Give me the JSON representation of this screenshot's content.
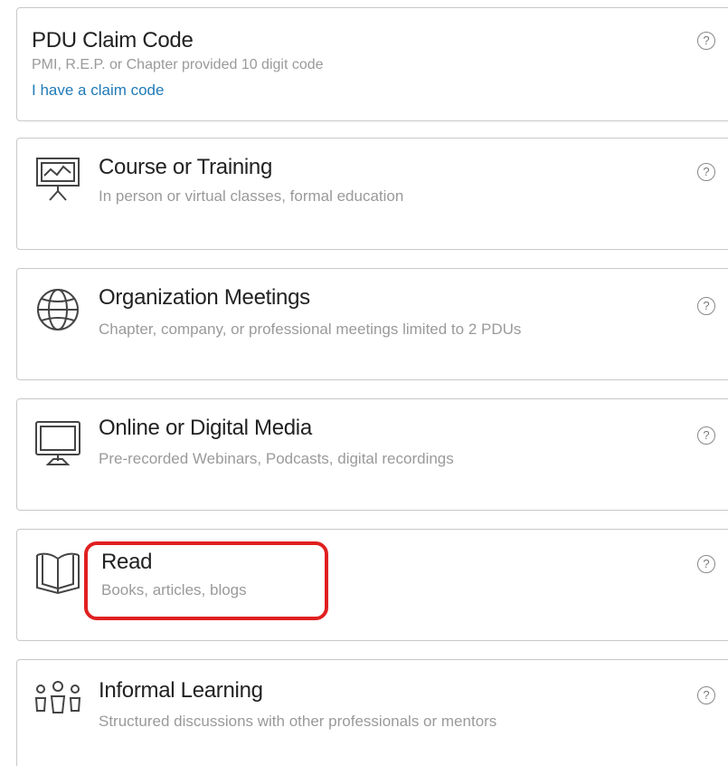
{
  "cards": [
    {
      "title": "PDU Claim Code",
      "description": "PMI, R.E.P. or Chapter provided 10 digit code",
      "link": "I have a claim code",
      "help": "?"
    },
    {
      "title": "Course or Training",
      "description": "In person or virtual classes, formal education",
      "icon": "presentation-board-icon",
      "help": "?"
    },
    {
      "title": "Organization Meetings",
      "description": "Chapter, company, or professional meetings limited to 2 PDUs",
      "icon": "globe-icon",
      "help": "?"
    },
    {
      "title": "Online or Digital Media",
      "description": "Pre-recorded Webinars, Podcasts, digital recordings",
      "icon": "monitor-icon",
      "help": "?"
    },
    {
      "title": "Read",
      "description": "Books, articles, blogs",
      "icon": "open-book-icon",
      "help": "?"
    },
    {
      "title": "Informal Learning",
      "description": "Structured discussions with other professionals or mentors",
      "icon": "people-group-icon",
      "help": "?"
    }
  ],
  "colors": {
    "border": "#c8c8c8",
    "title": "#222222",
    "description": "#9a9a9a",
    "link": "#1f7ab8",
    "highlight": "#e02020"
  }
}
